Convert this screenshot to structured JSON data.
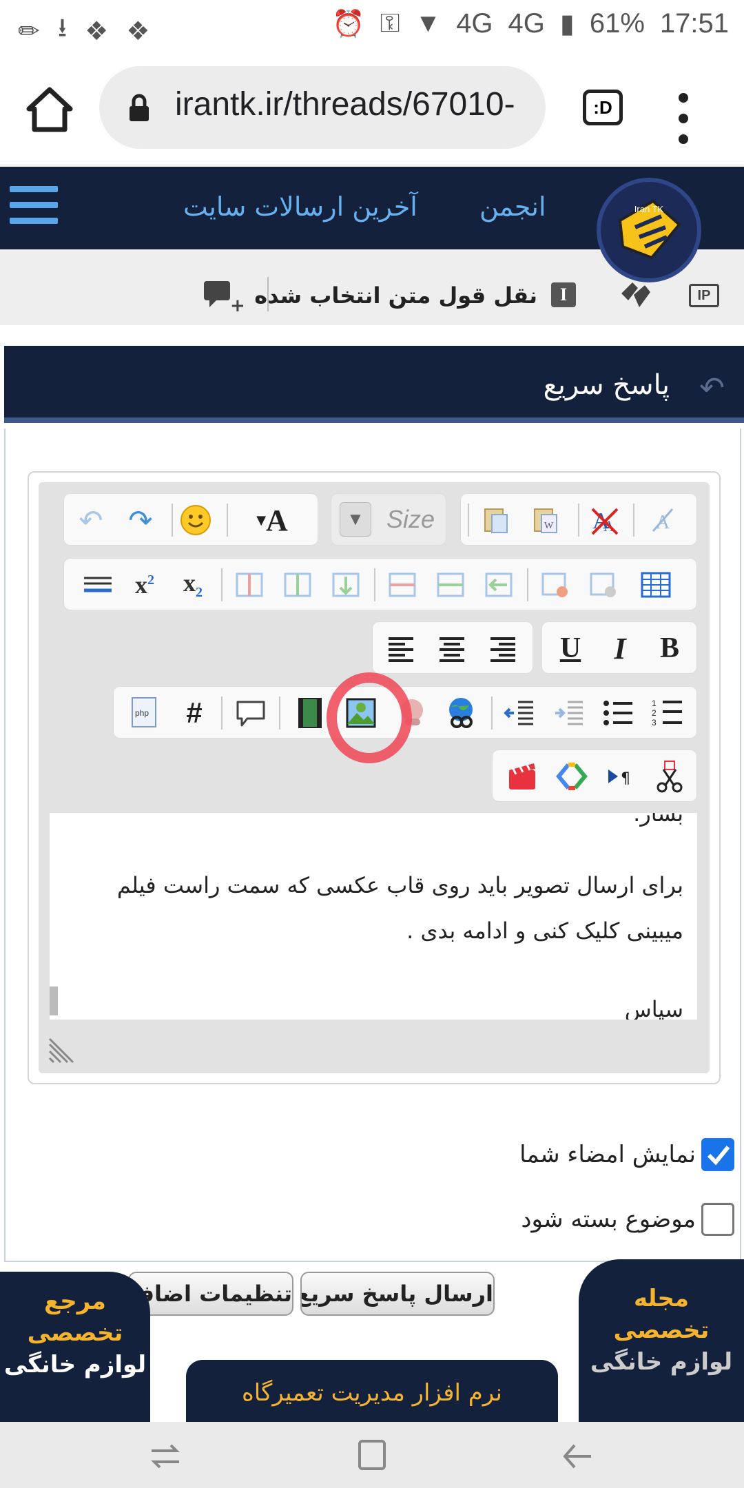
{
  "status_bar": {
    "time": "17:51",
    "battery": "61%",
    "network1": "4G",
    "network2": "4G"
  },
  "browser": {
    "url": "irantk.ir/threads/67010-",
    "tab_label": ":D"
  },
  "site_nav": {
    "link_forum": "انجمن",
    "link_latest": "آخرین ارسالات سایت",
    "logo_text": "Iran TK"
  },
  "quote_bar": {
    "quote_selected": "نقل قول متن انتخاب شده",
    "ip_label": "IP"
  },
  "quick_reply": {
    "title": "پاسخ سریع",
    "size_placeholder": "Size",
    "editor_lines": [
      "بشار.",
      "برای ارسال تصویر باید روی قاب عکسی که سمت راست فیلم",
      "میبینی کلیک کنی و ادامه بدی .",
      "سپاس"
    ],
    "option_show_signature": "نمایش امضاء شما",
    "option_close_topic": "موضوع بسته شود",
    "show_signature_checked": true,
    "close_topic_checked": false,
    "btn_send": "ارسال پاسخ سریع",
    "btn_settings": "تنظیمات اضافی"
  },
  "ads": {
    "left_line1": "مرجع",
    "left_line2": "تخصصی",
    "left_line3": "لوازم خانگی",
    "right_line1": "مجله",
    "right_line2": "تخصصی",
    "right_line3": "لوازم خانگی",
    "bottom": "نرم افزار مدیریت تعمیرگاه"
  },
  "colors": {
    "header_bg": "#14213d",
    "link_blue": "#66b1f0",
    "ad_gold": "#f5b32e",
    "annotation_red": "#ee4f5d"
  }
}
